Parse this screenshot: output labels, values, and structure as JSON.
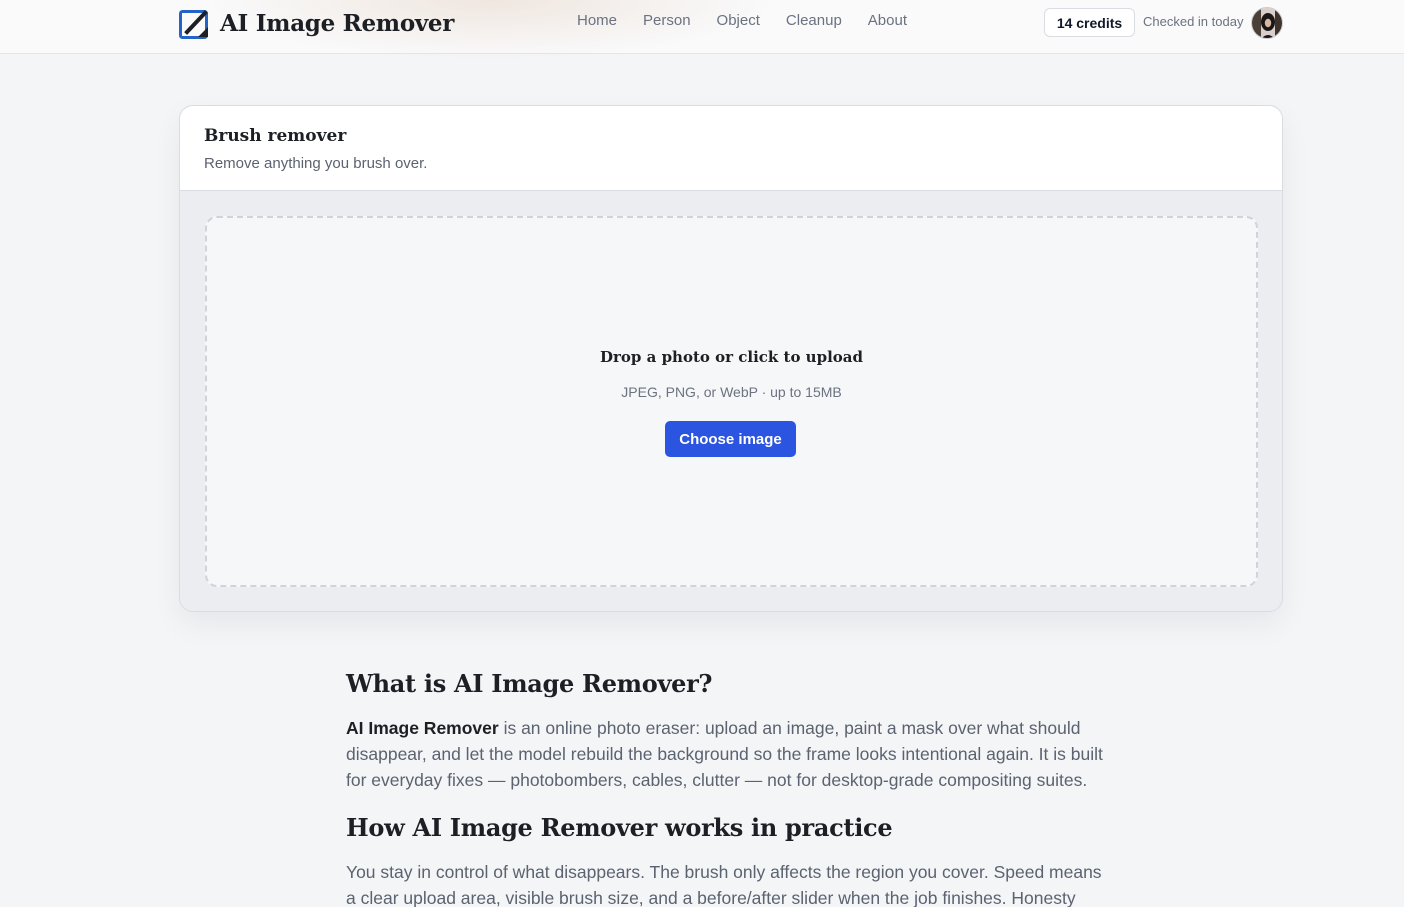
{
  "header": {
    "brand": "AI Image Remover",
    "logo_icon": "edit-square-icon",
    "nav": [
      "Home",
      "Person",
      "Object",
      "Cleanup",
      "About"
    ],
    "credits": "14 credits",
    "checkin_status": "Checked in today",
    "avatar_icon": "user-avatar"
  },
  "tool": {
    "title": "Brush remover",
    "subtitle": "Remove anything you brush over.",
    "dropzone": {
      "title": "Drop a photo or click to upload",
      "hint": "JPEG, PNG, or WebP · up to 15MB",
      "button": "Choose image"
    }
  },
  "article": {
    "h1": "What is AI Image Remover?",
    "p1_strong": "AI Image Remover",
    "p1_rest": " is an online photo eraser: upload an image, paint a mask over what should disappear, and let the model rebuild the background so the frame looks intentional again. It is built for everyday fixes — photobombers, cables, clutter — not for desktop-grade compositing suites.",
    "h2": "How AI Image Remover works in practice",
    "p2": "You stay in control of what disappears. The brush only affects the region you cover. Speed means a clear upload area, visible brush size, and a before/after slider when the job finishes. Honesty means"
  },
  "colors": {
    "accent": "#2b54e0",
    "page_bg": "#f4f5f7",
    "card_bg": "#ebedf1",
    "dropzone_bg": "#f6f7f9",
    "muted_text": "#5b6270"
  }
}
